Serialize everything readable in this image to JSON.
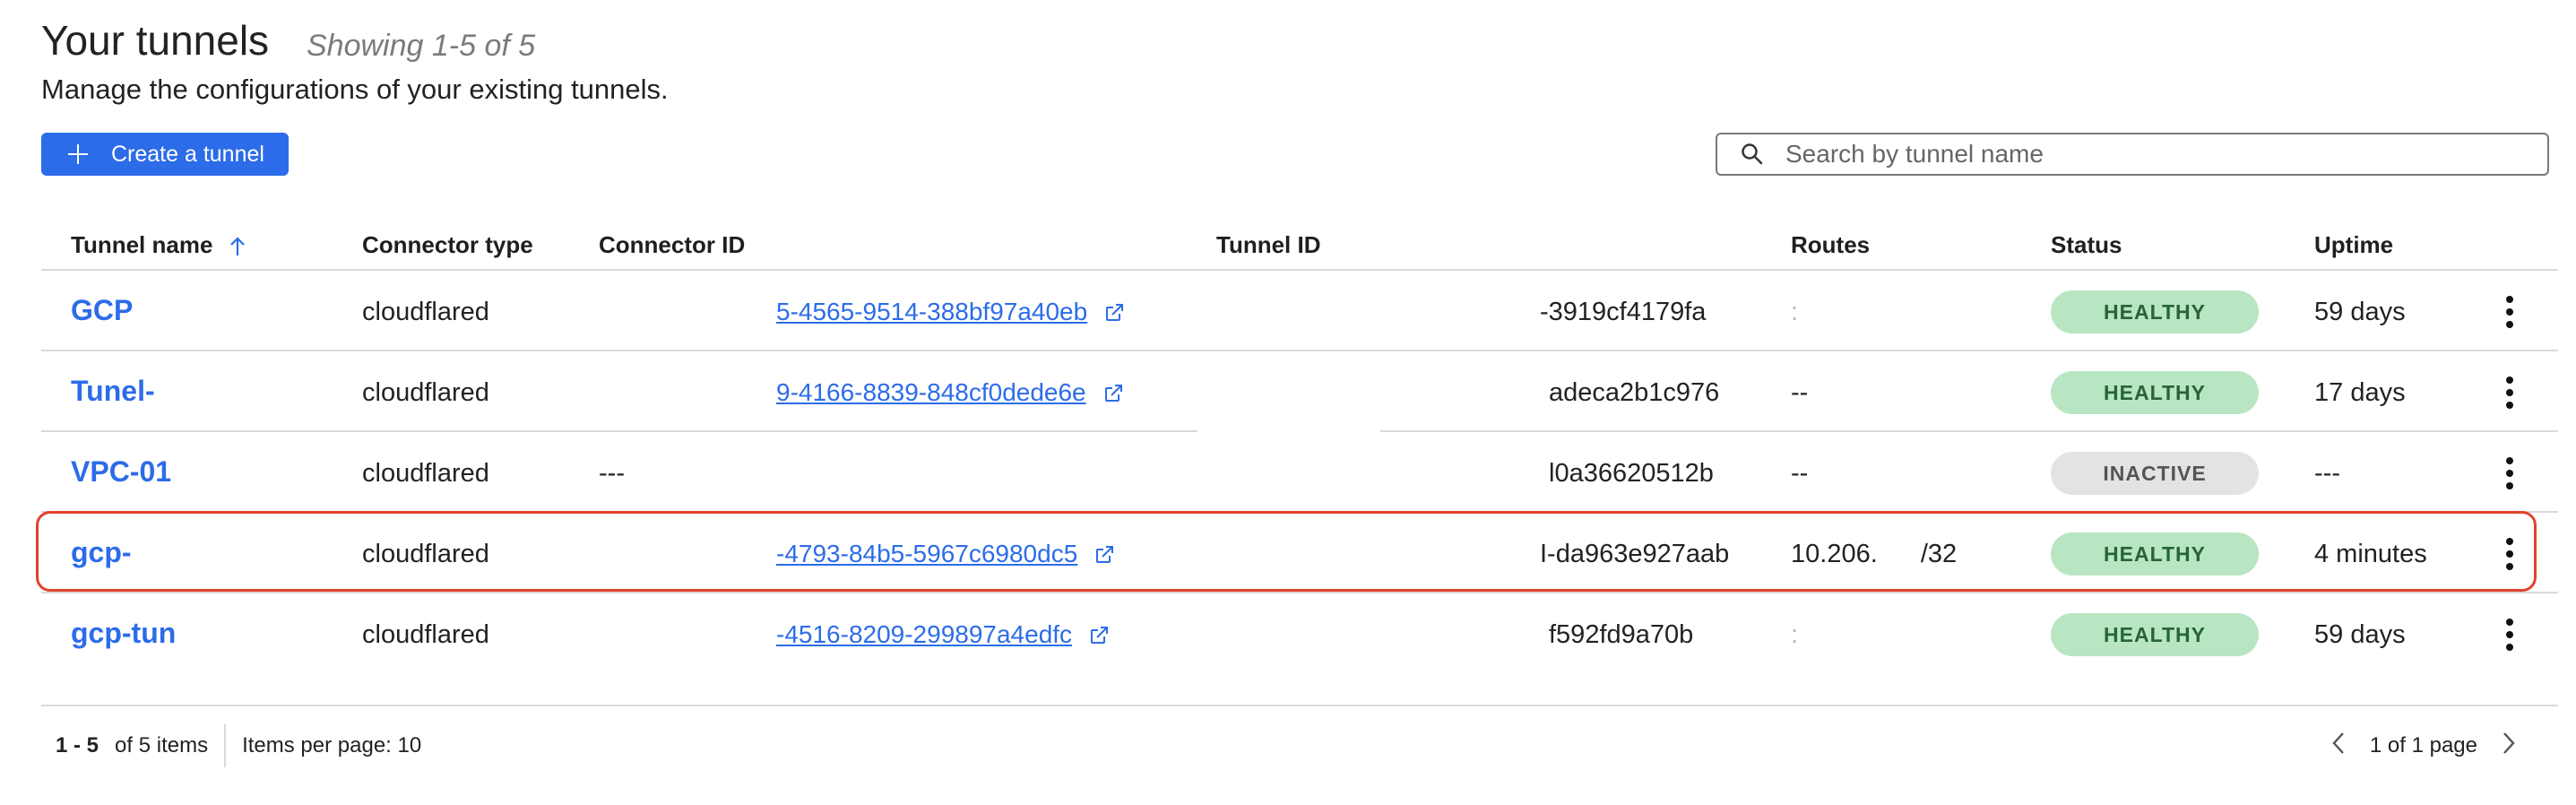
{
  "header": {
    "title": "Your tunnels",
    "count": "Showing 1-5 of 5",
    "description": "Manage the configurations of your existing tunnels."
  },
  "toolbar": {
    "create_label": "Create a tunnel",
    "search_placeholder": "Search by tunnel name"
  },
  "table": {
    "columns": {
      "name": "Tunnel name",
      "connector_type": "Connector type",
      "connector_id": "Connector ID",
      "tunnel_id": "Tunnel ID",
      "routes": "Routes",
      "status": "Status",
      "uptime": "Uptime"
    },
    "rows": [
      {
        "name": "GCP",
        "connector_type": "cloudflared",
        "connector_id": "5-4565-9514-388bf97a40eb",
        "tunnel_id": "-3919cf4179fa",
        "routes": ":",
        "status": "HEALTHY",
        "uptime": "59 days"
      },
      {
        "name": "Tunel-",
        "connector_type": "cloudflared",
        "connector_id": "9-4166-8839-848cf0dede6e",
        "tunnel_id": "adeca2b1c976",
        "routes": "--",
        "status": "HEALTHY",
        "uptime": "17 days"
      },
      {
        "name": "VPC-01",
        "connector_type": "cloudflared",
        "connector_id": "---",
        "tunnel_id": "l0a36620512b",
        "routes": "--",
        "status": "INACTIVE",
        "uptime": "---"
      },
      {
        "name": "gcp-",
        "connector_type": "cloudflared",
        "connector_id": "-4793-84b5-5967c6980dc5",
        "tunnel_id": "I-da963e927aab",
        "routes": "10.206.",
        "routes_suffix": "/32",
        "status": "HEALTHY",
        "uptime": "4 minutes"
      },
      {
        "name": "gcp-tun",
        "connector_type": "cloudflared",
        "connector_id": "-4516-8209-299897a4edfc",
        "tunnel_id": "f592fd9a70b",
        "routes": ":",
        "status": "HEALTHY",
        "uptime": "59 days"
      }
    ]
  },
  "footer": {
    "range": "1 - 5",
    "of_items": "of 5 items",
    "per_page": "Items per page: 10",
    "page_info": "1 of 1 page"
  },
  "colors": {
    "accent": "#2c6ce8",
    "healthy_bg": "#b8e6c3",
    "healthy_text": "#276534",
    "inactive_bg": "#e3e3e3",
    "highlight": "#e0432e"
  }
}
